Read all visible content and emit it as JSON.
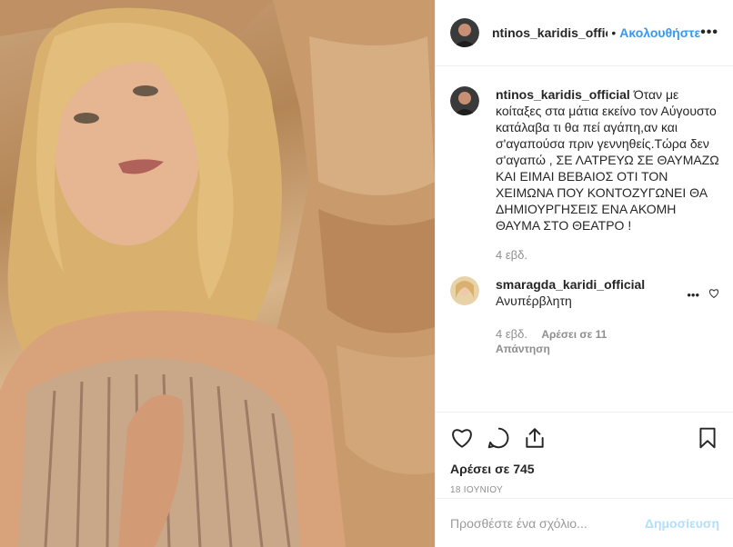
{
  "header": {
    "username": "ntinos_karidis_official",
    "separator": "•",
    "follow_label": "Ακολουθήστε",
    "more_label": "•••"
  },
  "caption": {
    "username": "ntinos_karidis_official",
    "text": "Όταν με κοίταξες στα μάτια εκείνο τον Αύγουστο κατάλαβα τι θα πεί αγάπη,αν και σ'αγαπούσα πριν γεννηθείς.Τώρα δεν σ'αγαπώ , ΣΕ ΛΑΤΡΕΥΩ ΣΕ ΘΑΥΜΑΖΩ ΚΑΙ ΕΙΜΑΙ ΒΕΒΑΙΟΣ ΟΤΙ ΤΟΝ ΧΕΙΜΩΝΑ ΠΟΥ ΚΟΝΤΟΖΥΓΩΝΕΙ ΘΑ ΔΗΜΙΟΥΡΓΗΣΕΙΣ ΕΝΑ ΑΚΟΜΗ ΘΑΥΜΑ ΣΤΟ ΘΕΑΤΡΟ !",
    "time": "4 εβδ."
  },
  "reply": {
    "username": "smaragda_karidi_official",
    "text": "Ανυπέρβλητη",
    "more_label": "•••",
    "time": "4 εβδ.",
    "likes": "Αρέσει σε 11",
    "reply_label": "Απάντηση"
  },
  "actions": {
    "icons": [
      "heart-icon",
      "comment-icon",
      "share-icon",
      "bookmark-icon"
    ],
    "likes": "Αρέσει σε 745",
    "date": "18 ΙΟΥΝΙΟΥ"
  },
  "add_comment": {
    "placeholder": "Προσθέστε ένα σχόλιο...",
    "post_label": "Δημοσίευση"
  },
  "colors": {
    "accent": "#3897f0",
    "post_disabled": "#b2dffc",
    "muted": "#8e8e8e"
  }
}
